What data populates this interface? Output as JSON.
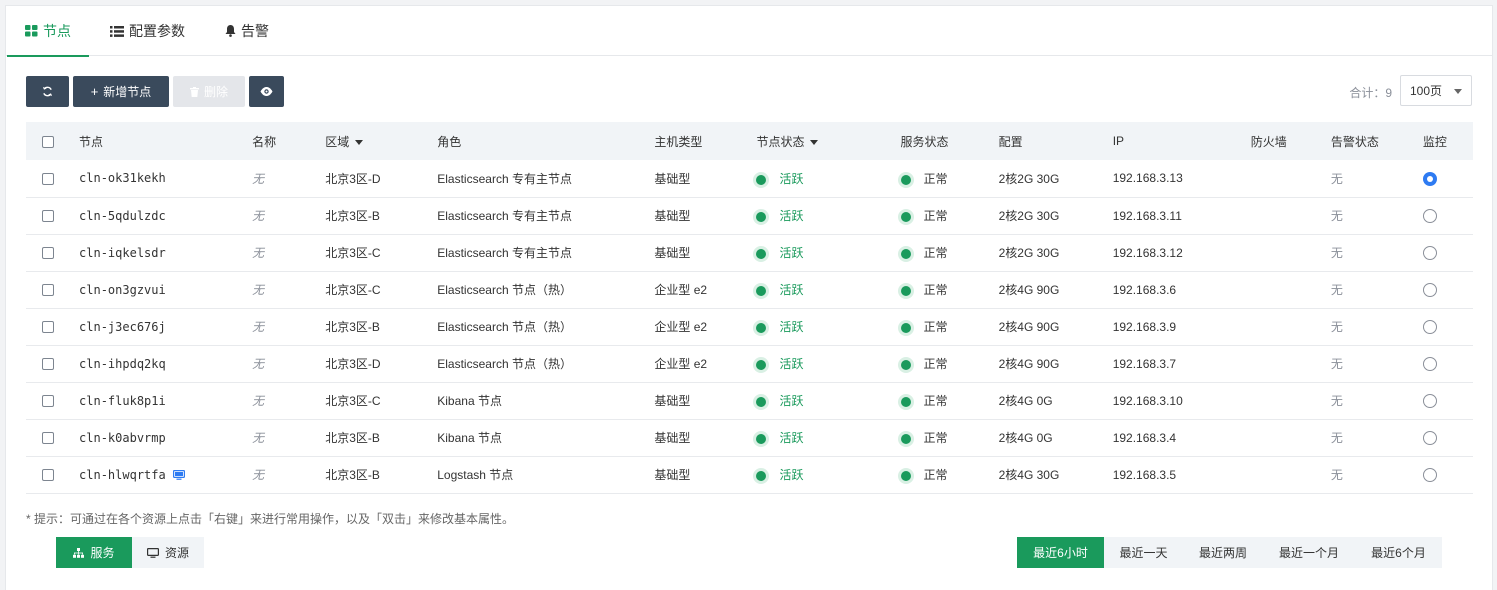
{
  "tabs": [
    {
      "label": "节点",
      "icon": "grid-icon",
      "active": true
    },
    {
      "label": "配置参数",
      "icon": "list-icon",
      "active": false
    },
    {
      "label": "告警",
      "icon": "bell-icon",
      "active": false
    }
  ],
  "toolbar": {
    "refresh_icon": "refresh-icon",
    "add_label": "新增节点",
    "delete_label": "删除",
    "view_icon": "eye-icon"
  },
  "pagination": {
    "total_label": "合计：9",
    "page_size": "100页"
  },
  "table": {
    "headers": {
      "node": "节点",
      "name": "名称",
      "zone": "区域",
      "role": "角色",
      "host_type": "主机类型",
      "node_status": "节点状态",
      "service_status": "服务状态",
      "config": "配置",
      "ip": "IP",
      "firewall": "防火墙",
      "alert_status": "告警状态",
      "monitor": "监控"
    },
    "rows": [
      {
        "node": "cln-ok31kekh",
        "name": "无",
        "zone": "北京3区-D",
        "role": "Elasticsearch 专有主节点",
        "host_type": "基础型",
        "node_status": "活跃",
        "service_status": "正常",
        "config": "2核2G 30G",
        "ip": "192.168.3.13",
        "firewall": "",
        "alert_status": "无",
        "monitor": true
      },
      {
        "node": "cln-5qdulzdc",
        "name": "无",
        "zone": "北京3区-B",
        "role": "Elasticsearch 专有主节点",
        "host_type": "基础型",
        "node_status": "活跃",
        "service_status": "正常",
        "config": "2核2G 30G",
        "ip": "192.168.3.11",
        "firewall": "",
        "alert_status": "无",
        "monitor": false
      },
      {
        "node": "cln-iqkelsdr",
        "name": "无",
        "zone": "北京3区-C",
        "role": "Elasticsearch 专有主节点",
        "host_type": "基础型",
        "node_status": "活跃",
        "service_status": "正常",
        "config": "2核2G 30G",
        "ip": "192.168.3.12",
        "firewall": "",
        "alert_status": "无",
        "monitor": false
      },
      {
        "node": "cln-on3gzvui",
        "name": "无",
        "zone": "北京3区-C",
        "role": "Elasticsearch 节点（热）",
        "host_type": "企业型 e2",
        "node_status": "活跃",
        "service_status": "正常",
        "config": "2核4G 90G",
        "ip": "192.168.3.6",
        "firewall": "",
        "alert_status": "无",
        "monitor": false
      },
      {
        "node": "cln-j3ec676j",
        "name": "无",
        "zone": "北京3区-B",
        "role": "Elasticsearch 节点（热）",
        "host_type": "企业型 e2",
        "node_status": "活跃",
        "service_status": "正常",
        "config": "2核4G 90G",
        "ip": "192.168.3.9",
        "firewall": "",
        "alert_status": "无",
        "monitor": false
      },
      {
        "node": "cln-ihpdq2kq",
        "name": "无",
        "zone": "北京3区-D",
        "role": "Elasticsearch 节点（热）",
        "host_type": "企业型 e2",
        "node_status": "活跃",
        "service_status": "正常",
        "config": "2核4G 90G",
        "ip": "192.168.3.7",
        "firewall": "",
        "alert_status": "无",
        "monitor": false
      },
      {
        "node": "cln-fluk8p1i",
        "name": "无",
        "zone": "北京3区-C",
        "role": "Kibana 节点",
        "host_type": "基础型",
        "node_status": "活跃",
        "service_status": "正常",
        "config": "2核4G 0G",
        "ip": "192.168.3.10",
        "firewall": "",
        "alert_status": "无",
        "monitor": false
      },
      {
        "node": "cln-k0abvrmp",
        "name": "无",
        "zone": "北京3区-B",
        "role": "Kibana 节点",
        "host_type": "基础型",
        "node_status": "活跃",
        "service_status": "正常",
        "config": "2核4G 0G",
        "ip": "192.168.3.4",
        "firewall": "",
        "alert_status": "无",
        "monitor": false
      },
      {
        "node": "cln-hlwqrtfa",
        "name": "无",
        "zone": "北京3区-B",
        "role": "Logstash 节点",
        "host_type": "基础型",
        "node_status": "活跃",
        "service_status": "正常",
        "config": "2核4G 30G",
        "ip": "192.168.3.5",
        "firewall": "",
        "alert_status": "无",
        "monitor": false,
        "has_console_icon": true
      }
    ]
  },
  "tip": "* 提示：可通过在各个资源上点击「右键」来进行常用操作，以及「双击」来修改基本属性。",
  "bottom_tabs": [
    {
      "label": "服务",
      "icon": "sitemap-icon",
      "active": true
    },
    {
      "label": "资源",
      "icon": "monitor-icon",
      "active": false
    }
  ],
  "time_ranges": [
    {
      "label": "最近6小时",
      "active": true
    },
    {
      "label": "最近一天",
      "active": false
    },
    {
      "label": "最近两周",
      "active": false
    },
    {
      "label": "最近一个月",
      "active": false
    },
    {
      "label": "最近6个月",
      "active": false
    }
  ],
  "colors": {
    "accent_green": "#1a9a5c",
    "dark_button": "#3a4a5c",
    "radio_selected": "#2e7bf2"
  }
}
